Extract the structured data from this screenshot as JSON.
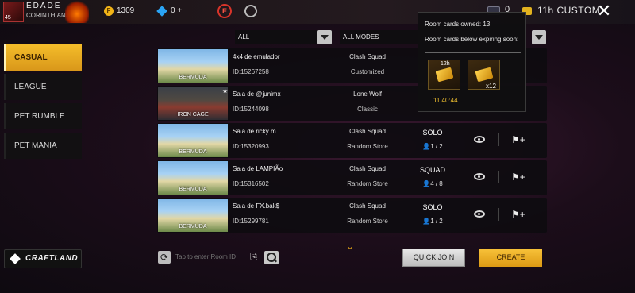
{
  "player": {
    "name": "EDADE",
    "clan": "CORINTHIANS",
    "level": "45"
  },
  "currency": {
    "gold_symbol": "F",
    "gold": "1309",
    "diamonds": "0 +"
  },
  "top_badge": "E",
  "top_right": {
    "room_cards": "0",
    "mode": "11h CUSTOM",
    "close": "✕"
  },
  "nav": [
    {
      "label": "CASUAL",
      "active": true
    },
    {
      "label": "LEAGUE"
    },
    {
      "label": "PET RUMBLE"
    },
    {
      "label": "PET MANIA"
    }
  ],
  "craftland_label": "CRAFTLAND",
  "filters": {
    "region": "ALL",
    "modes": "ALL MODES"
  },
  "rooms": [
    {
      "map": "BERMUDA",
      "title": "4x4 de emulador",
      "id": "ID:15267258",
      "mode": "Clash Squad",
      "sub": "Customized",
      "team": "",
      "count": ""
    },
    {
      "map": "IRON CAGE",
      "title": "Sala de @junimx",
      "id": "ID:15244098",
      "mode": "Lone Wolf",
      "sub": "Classic",
      "team": "",
      "count": ""
    },
    {
      "map": "BERMUDA",
      "title": "Sala de ricky    m",
      "id": "ID:15320993",
      "mode": "Clash Squad",
      "sub": "Random Store",
      "team": "SOLO",
      "count": "1 / 2"
    },
    {
      "map": "BERMUDA",
      "title": "Sala de LAMPIÃo",
      "id": "ID:15316502",
      "mode": "Clash Squad",
      "sub": "Random Store",
      "team": "SQUAD",
      "count": "4 / 8"
    },
    {
      "map": "BERMUDA",
      "title": "Sala de FX.bak$",
      "id": "ID:15299781",
      "mode": "Clash Squad",
      "sub": "Random Store",
      "team": "SOLO",
      "count": "1 / 2"
    }
  ],
  "bottom": {
    "room_input_placeholder": "Tap to enter Room ID",
    "quick_join": "QUICK JOIN",
    "create": "CREATE"
  },
  "popup": {
    "owned": "Room cards owned: 13",
    "expiring": "Room cards below expiring soon:",
    "card1_time": "12h",
    "card1_expire": "11:40:44",
    "card2_count": "x12"
  },
  "icons": {
    "person": "👤",
    "flag_plus": "⚑+"
  },
  "colors": {
    "accent": "#f4bd2a",
    "badge_red": "#d9342a"
  }
}
